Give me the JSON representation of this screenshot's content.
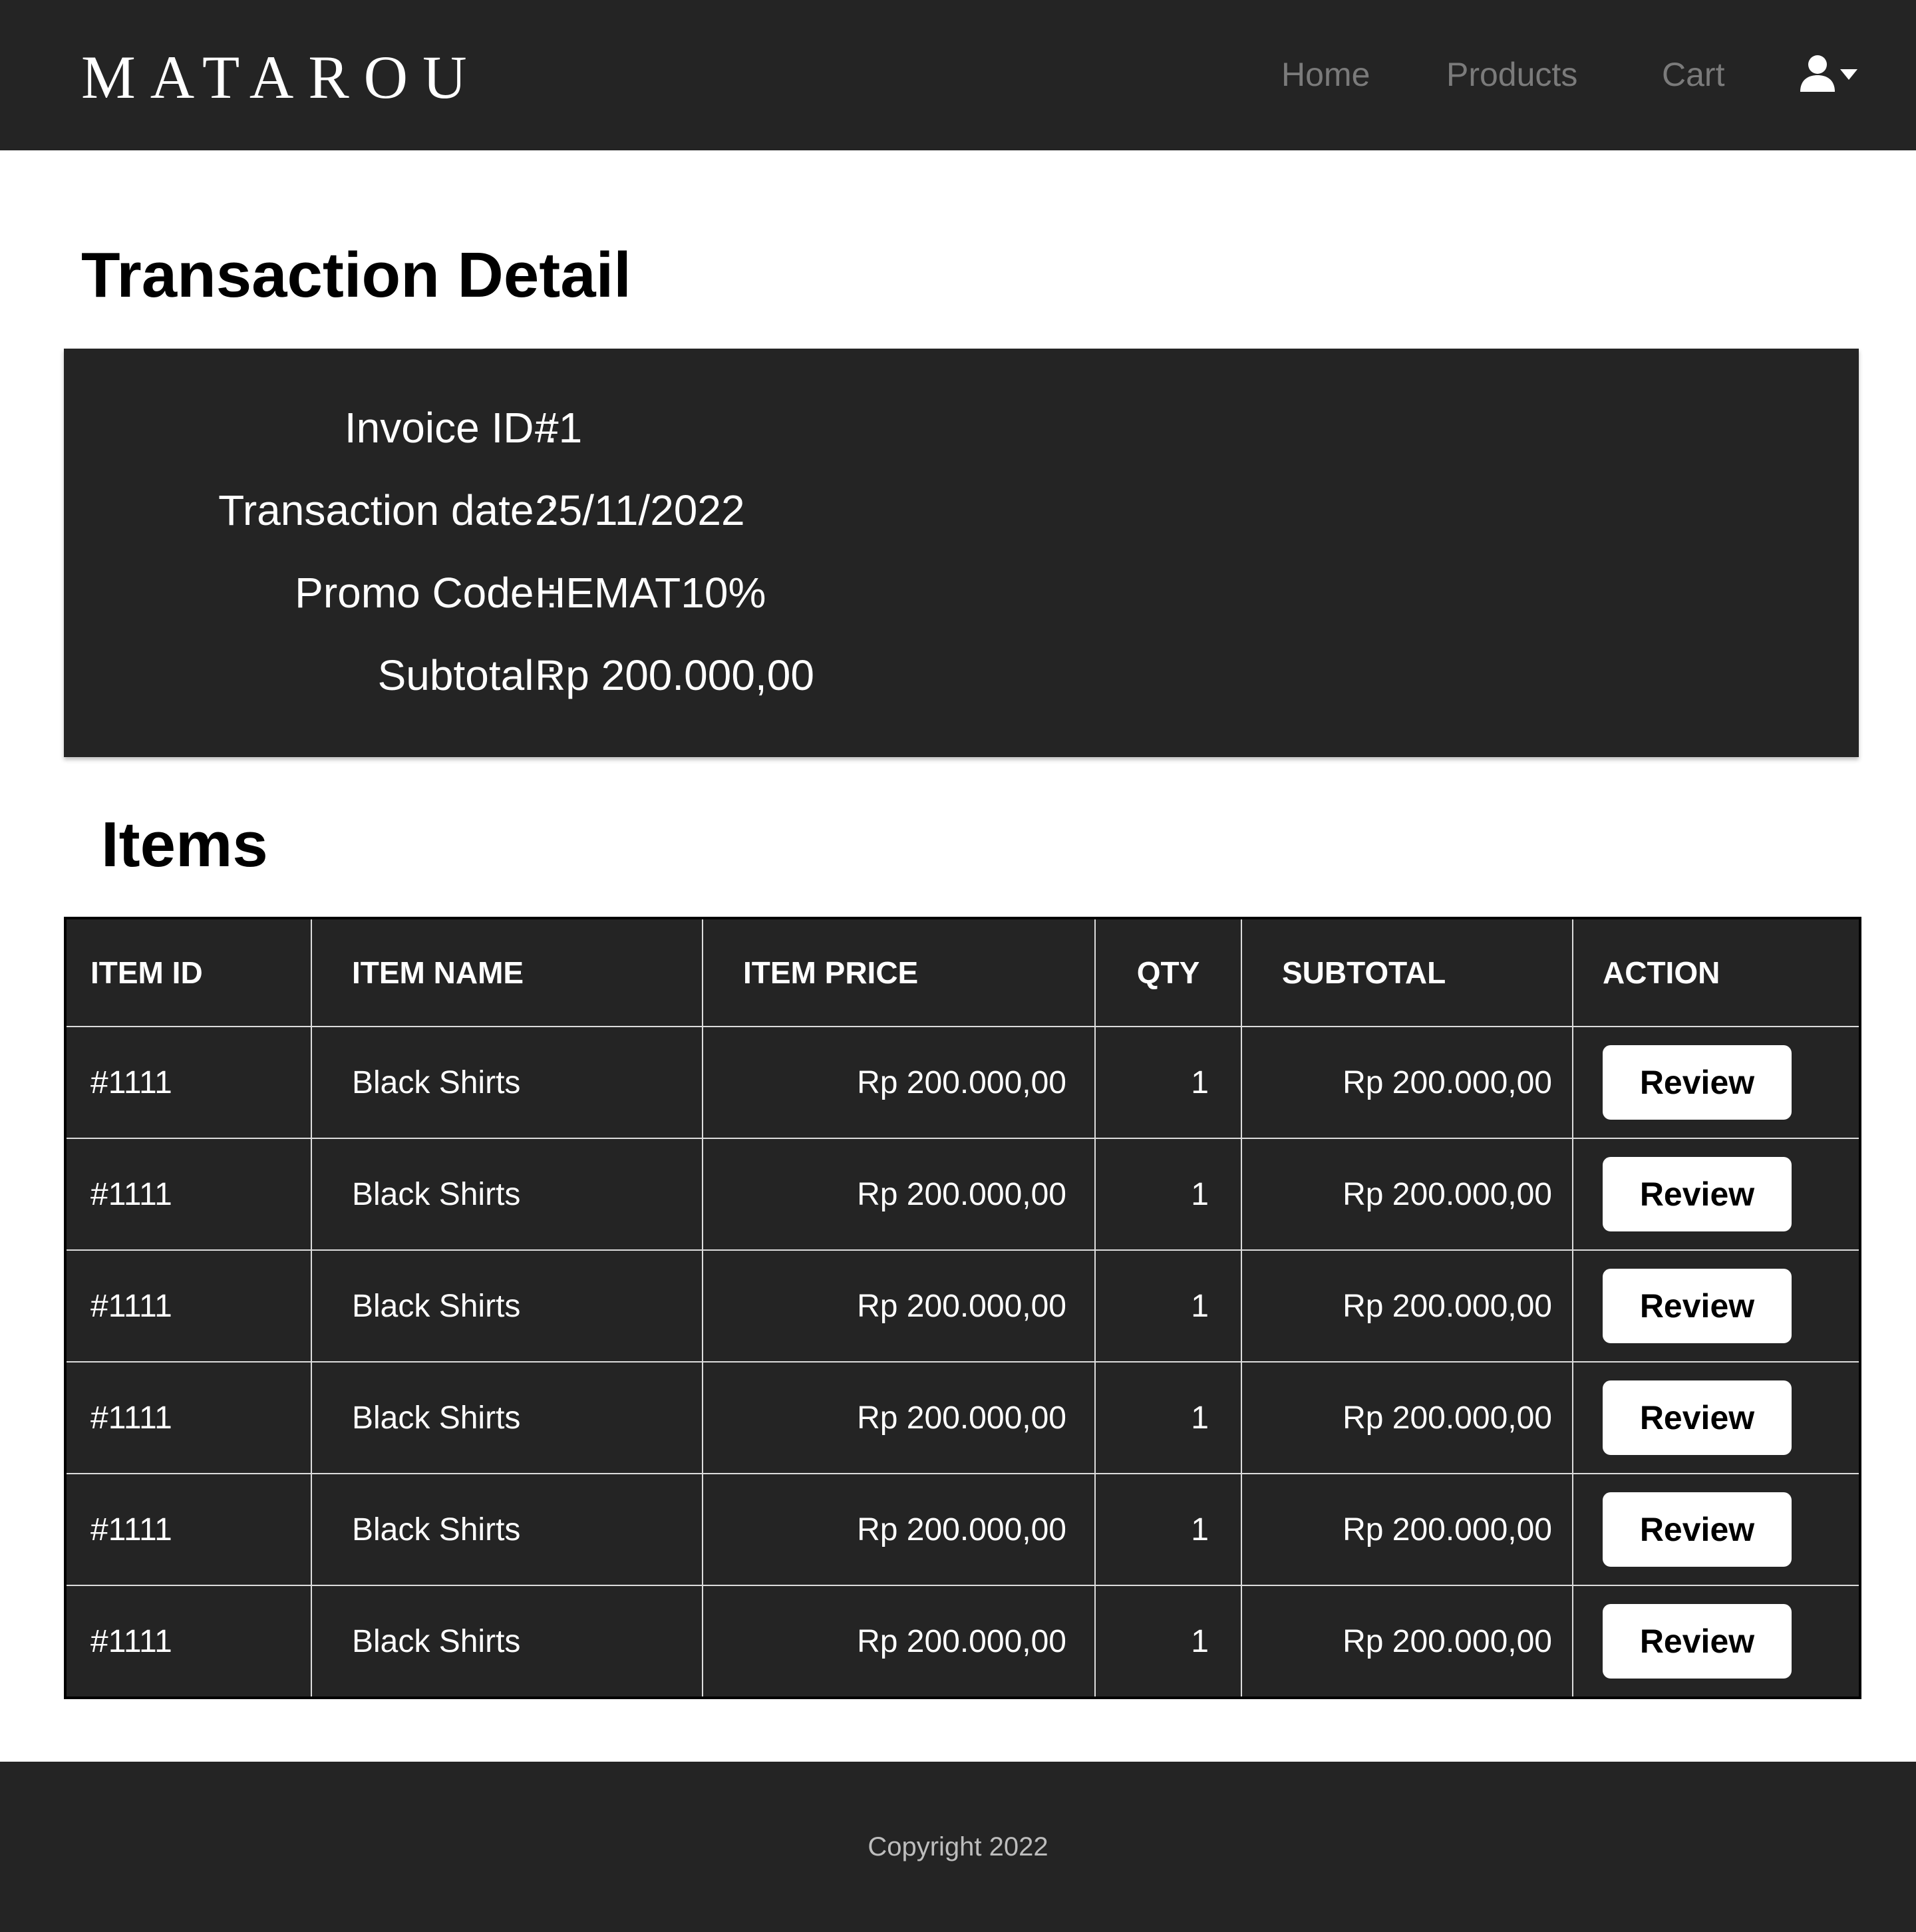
{
  "navbar": {
    "brand": "MATAROU",
    "links": [
      {
        "label": "Home"
      },
      {
        "label": "Products"
      },
      {
        "label": "Cart"
      }
    ],
    "user_icon": "user-icon",
    "dropdown_icon": "caret-down-icon"
  },
  "page": {
    "title": "Transaction Detail"
  },
  "transaction": {
    "invoice_label": "Invoice ID :",
    "invoice_value": "#1",
    "date_label": "Transaction date :",
    "date_value": "25/11/2022",
    "promo_label": "Promo Code :",
    "promo_value": "HEMAT10%",
    "subtotal_label": "Subtotal :",
    "subtotal_value": "Rp 200.000,00"
  },
  "items": {
    "title": "Items",
    "columns": [
      "ITEM ID",
      "ITEM NAME",
      "ITEM PRICE",
      "QTY",
      "SUBTOTAL",
      "ACTION"
    ],
    "rows": [
      {
        "id": "#1111",
        "name": "Black Shirts",
        "price": "Rp 200.000,00",
        "qty": "1",
        "subtotal": "Rp 200.000,00",
        "action": "Review"
      },
      {
        "id": "#1111",
        "name": "Black Shirts",
        "price": "Rp 200.000,00",
        "qty": "1",
        "subtotal": "Rp 200.000,00",
        "action": "Review"
      },
      {
        "id": "#1111",
        "name": "Black Shirts",
        "price": "Rp 200.000,00",
        "qty": "1",
        "subtotal": "Rp 200.000,00",
        "action": "Review"
      },
      {
        "id": "#1111",
        "name": "Black Shirts",
        "price": "Rp 200.000,00",
        "qty": "1",
        "subtotal": "Rp 200.000,00",
        "action": "Review"
      },
      {
        "id": "#1111",
        "name": "Black Shirts",
        "price": "Rp 200.000,00",
        "qty": "1",
        "subtotal": "Rp 200.000,00",
        "action": "Review"
      },
      {
        "id": "#1111",
        "name": "Black Shirts",
        "price": "Rp 200.000,00",
        "qty": "1",
        "subtotal": "Rp 200.000,00",
        "action": "Review"
      }
    ]
  },
  "footer": {
    "copyright": "Copyright 2022"
  },
  "colors": {
    "dark": "#242424",
    "nav_link": "#7b7b7b",
    "white": "#ffffff"
  }
}
